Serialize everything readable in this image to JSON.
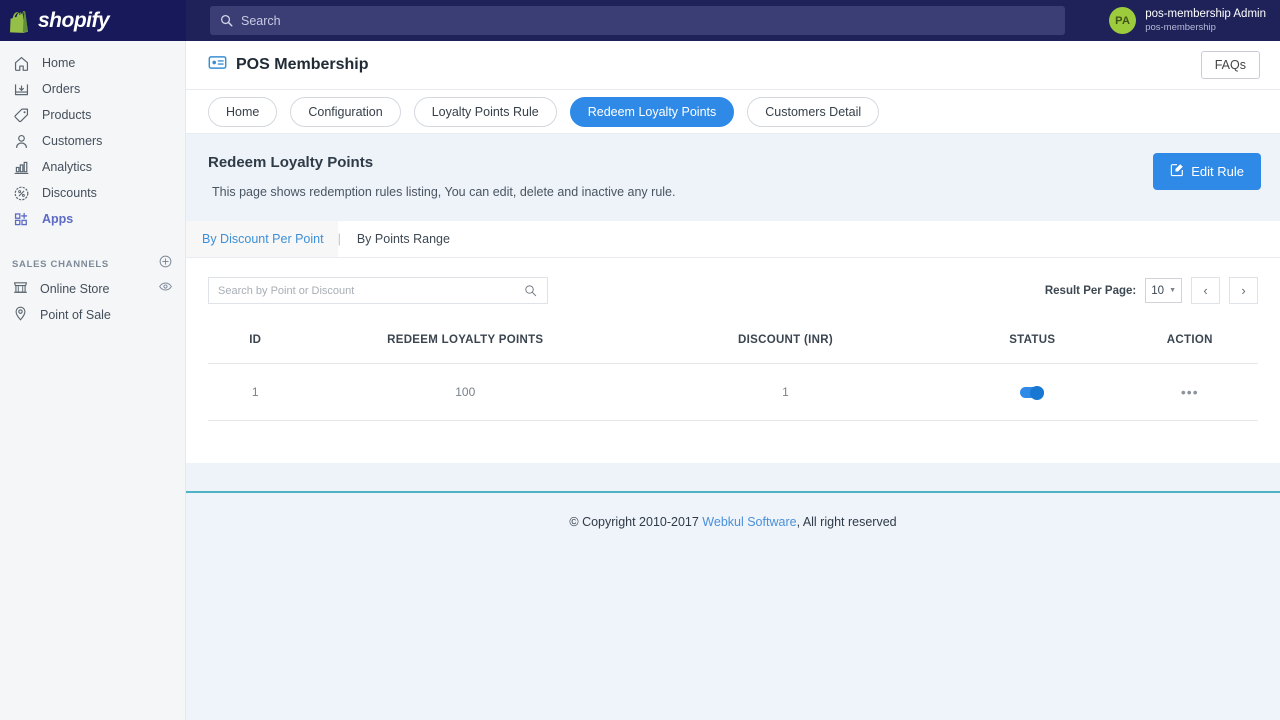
{
  "topbar": {
    "brand": "shopify",
    "search": {
      "placeholder": "Search",
      "icon": "search-icon"
    },
    "user": {
      "initials": "PA",
      "name": "pos-membership Admin",
      "store": "pos-membership"
    }
  },
  "sidebar": {
    "items": [
      {
        "label": "Home",
        "icon": "home-icon",
        "active": false
      },
      {
        "label": "Orders",
        "icon": "orders-icon",
        "active": false
      },
      {
        "label": "Products",
        "icon": "tag-icon",
        "active": false
      },
      {
        "label": "Customers",
        "icon": "person-icon",
        "active": false
      },
      {
        "label": "Analytics",
        "icon": "bar-chart-icon",
        "active": false
      },
      {
        "label": "Discounts",
        "icon": "discount-badge-icon",
        "active": false
      },
      {
        "label": "Apps",
        "icon": "apps-grid-icon",
        "active": true
      }
    ],
    "section_title": "SALES CHANNELS",
    "add_icon": "plus-circle-icon",
    "channels": [
      {
        "label": "Online Store",
        "icon": "storefront-icon",
        "trailing_icon": "eye-icon"
      },
      {
        "label": "Point of Sale",
        "icon": "location-pin-icon",
        "trailing_icon": ""
      }
    ]
  },
  "app_header": {
    "icon": "id-card-icon",
    "title": "POS Membership",
    "faqs_label": "FAQs"
  },
  "tabs": [
    {
      "label": "Home",
      "active": false
    },
    {
      "label": "Configuration",
      "active": false
    },
    {
      "label": "Loyalty Points Rule",
      "active": false
    },
    {
      "label": "Redeem Loyalty Points",
      "active": true
    },
    {
      "label": "Customers Detail",
      "active": false
    }
  ],
  "panel": {
    "title": "Redeem Loyalty Points",
    "description": "This page shows redemption rules listing, You can edit, delete and inactive any rule.",
    "edit_button": {
      "label": "Edit Rule",
      "icon": "edit-square-icon"
    }
  },
  "subtabs": {
    "first": "By Discount Per Point",
    "separator": "|",
    "second": "By Points Range"
  },
  "toolbar": {
    "search_placeholder": "Search by Point or Discount",
    "search_value": "",
    "search_icon": "search-icon",
    "result_per_page_label": "Result Per Page:",
    "result_per_page_value": "10",
    "prev_icon": "chevron-left-icon",
    "next_icon": "chevron-right-icon"
  },
  "table": {
    "columns": [
      "ID",
      "REDEEM LOYALTY POINTS",
      "DISCOUNT (INR)",
      "STATUS",
      "ACTION"
    ],
    "rows": [
      {
        "id": "1",
        "points": "100",
        "discount": "1",
        "status_on": true,
        "action": "•••"
      }
    ]
  },
  "footer": {
    "prefix": "© Copyright 2010-2017 ",
    "link": "Webkul Software",
    "suffix": ", All right reserved"
  },
  "colors": {
    "topbar": "#1f2259",
    "accent_blue": "#2e8ae6",
    "sidebar_active": "#5c6ac4",
    "panel_bg": "#eef2f9",
    "footer_rule": "#4fb3c4",
    "avatar_green": "#9ccb3b"
  }
}
